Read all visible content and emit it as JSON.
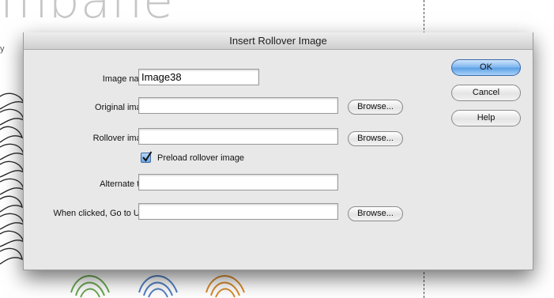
{
  "background": {
    "heading_fragment": "mbane",
    "text_fragment": "y"
  },
  "dialog": {
    "title": "Insert Rollover Image",
    "fields": {
      "image_name": {
        "label": "Image name:",
        "value": "Image38"
      },
      "original_image": {
        "label": "Original image:",
        "value": ""
      },
      "rollover_image": {
        "label": "Rollover image:",
        "value": ""
      },
      "alternate_text": {
        "label": "Alternate text:",
        "value": ""
      },
      "go_to_url": {
        "label": "When clicked, Go to URL:",
        "value": ""
      }
    },
    "browse_label": "Browse...",
    "preload": {
      "label": "Preload rollover image",
      "checked": true
    },
    "buttons": {
      "ok": "OK",
      "cancel": "Cancel",
      "help": "Help"
    }
  },
  "colors": {
    "default_button": "#6aa9ec",
    "dialog_background": "#e8e8e8",
    "art_green": "#6aa84f",
    "art_blue": "#4f7fc4",
    "art_orange": "#d98a2b"
  }
}
